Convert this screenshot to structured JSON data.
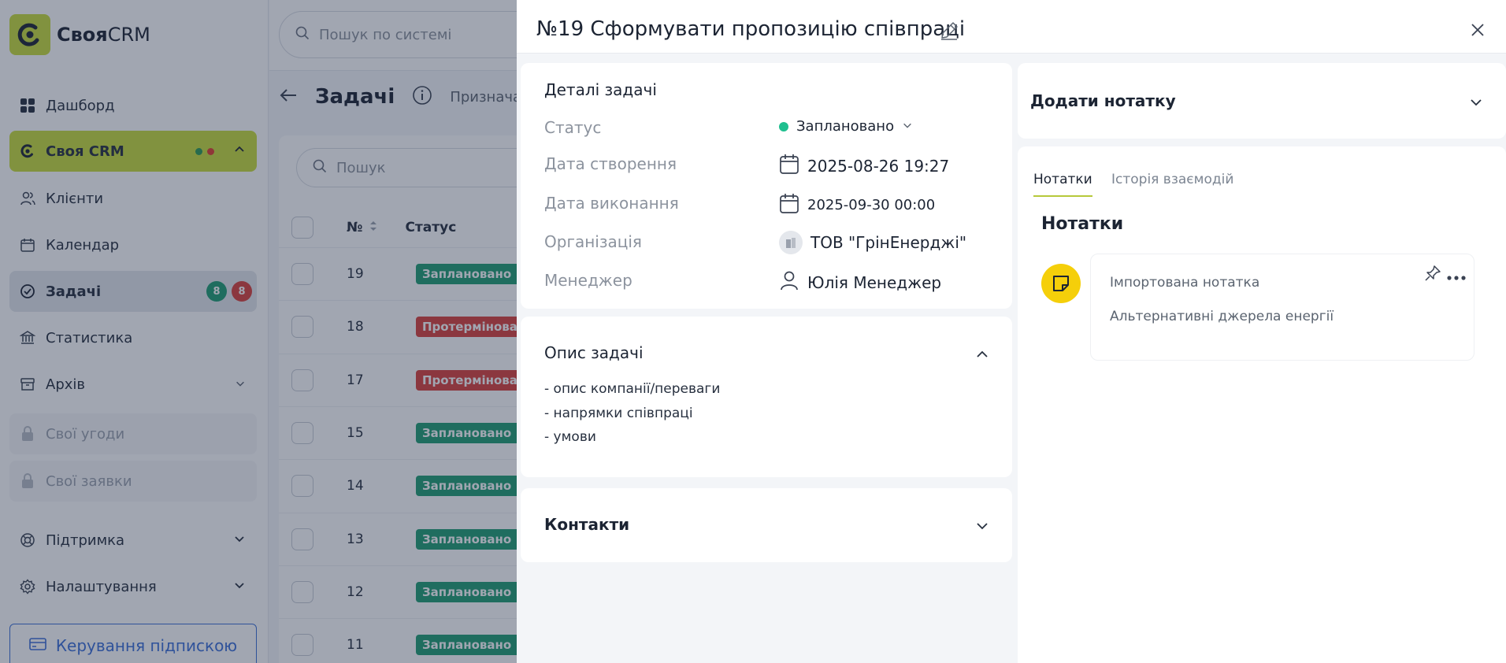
{
  "app": {
    "brand_bold": "Своя",
    "brand_rest": "CRM"
  },
  "sidebar": {
    "items": [
      {
        "label": "Дашборд",
        "icon": "dashboard-icon"
      },
      {
        "label": "Своя CRM",
        "icon": "crm-logo-icon",
        "dots": [
          "#2e9a55",
          "#e0412f"
        ]
      },
      {
        "label": "Клієнти",
        "icon": "users-icon"
      },
      {
        "label": "Календар",
        "icon": "calendar-icon"
      },
      {
        "label": "Задачі",
        "icon": "check-circle-icon",
        "badges": [
          "8",
          "8"
        ]
      },
      {
        "label": "Статистика",
        "icon": "bank-icon"
      },
      {
        "label": "Архів",
        "icon": "archive-icon"
      },
      {
        "label": "Свої угоди",
        "icon": "lock-icon"
      },
      {
        "label": "Свої заявки",
        "icon": "lock-icon"
      },
      {
        "label": "Підтримка",
        "icon": "lifebuoy-icon"
      },
      {
        "label": "Налаштування",
        "icon": "gear-icon"
      }
    ],
    "subscription_button": "Керування підпискою"
  },
  "topbar": {
    "search_placeholder": "Пошук по системі"
  },
  "page": {
    "title": "Задачі",
    "hint": "Призначай"
  },
  "table": {
    "search_placeholder": "Пошук",
    "columns": [
      "№",
      "Статус"
    ],
    "rows": [
      {
        "num": "19",
        "status": "Заплановано",
        "color": "#1f9d72"
      },
      {
        "num": "18",
        "status": "Протерміноване",
        "color": "#d9413b"
      },
      {
        "num": "17",
        "status": "Протерміноване",
        "color": "#d9413b"
      },
      {
        "num": "15",
        "status": "Заплановано",
        "color": "#1f9d72"
      },
      {
        "num": "14",
        "status": "Заплановано",
        "color": "#1f9d72"
      },
      {
        "num": "13",
        "status": "Заплановано",
        "color": "#1f9d72"
      },
      {
        "num": "12",
        "status": "Заплановано",
        "color": "#1f9d72"
      },
      {
        "num": "11",
        "status": "Заплановано",
        "color": "#1f9d72"
      }
    ]
  },
  "drawer": {
    "title": "№19 Сформувати пропозицію співпраці",
    "details": {
      "heading": "Деталі задачі",
      "status_label": "Статус",
      "status_value": "Заплановано",
      "status_color": "#1fbf8f",
      "created_label": "Дата створення",
      "created_value": "2025-08-26 19:27",
      "due_label": "Дата виконання",
      "due_value": "2025-09-30 00:00",
      "org_label": "Організація",
      "org_value": "ТОВ \"ГрінЕнерджі\"",
      "manager_label": "Менеджер",
      "manager_value": "Юлія Менеджер"
    },
    "description": {
      "heading": "Опис задачі",
      "lines": [
        "- опис компанії/переваги",
        "- напрямки співпраці",
        "- умови"
      ]
    },
    "contacts": {
      "heading": "Контакти"
    },
    "add_note": {
      "heading": "Додати нотатку"
    },
    "notes": {
      "tabs": [
        "Нотатки",
        "Історія взаємодій"
      ],
      "heading": "Нотатки",
      "items": [
        {
          "title": "Імпортована нотатка",
          "body": "Альтернативні джерела енергії"
        }
      ]
    }
  },
  "colors": {
    "accent": "#c8dd3c",
    "brand_blue": "#3c6fd8",
    "note_yellow": "#f5cf0a"
  }
}
